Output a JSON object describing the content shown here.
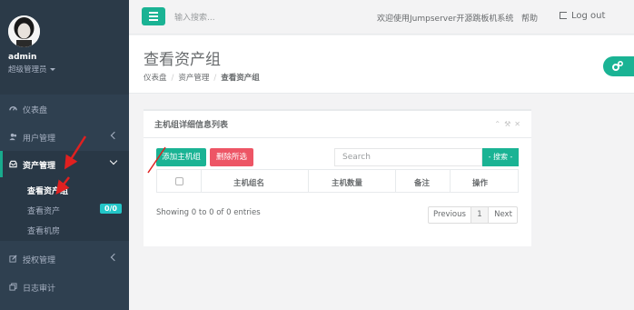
{
  "sidebar": {
    "profile": {
      "name": "admin",
      "role": "超级管理员"
    },
    "items": [
      {
        "label": "仪表盘",
        "icon": "dashboard-icon"
      },
      {
        "label": "用户管理",
        "icon": "users-icon"
      },
      {
        "label": "资产管理",
        "icon": "inbox-icon"
      },
      {
        "label": "授权管理",
        "icon": "edit-icon"
      },
      {
        "label": "日志审计",
        "icon": "copy-icon"
      }
    ],
    "sub_items": [
      {
        "label": "查看资产组"
      },
      {
        "label": "查看资产"
      },
      {
        "label": "查看机房"
      }
    ],
    "asset_badge": "0/0"
  },
  "topbar": {
    "search_placeholder": "输入搜索...",
    "welcome": "欢迎使用Jumpserver开源跳板机系统",
    "help": "帮助",
    "logout": "Log out"
  },
  "page": {
    "title": "查看资产组",
    "breadcrumb": [
      "仪表盘",
      "资产管理",
      "查看资产组"
    ]
  },
  "panel": {
    "title": "主机组详细信息列表",
    "add_button": "添加主机组",
    "delete_button": "删除所选",
    "search_placeholder": "Search",
    "search_button": "- 搜索 -",
    "columns": [
      "主机组名",
      "主机数量",
      "备注",
      "操作"
    ],
    "showing": "Showing 0 to 0 of 0 entries",
    "pagination": {
      "prev": "Previous",
      "page": "1",
      "next": "Next"
    }
  },
  "colors": {
    "sidebar": "#2f4050",
    "accent": "#1ab394",
    "danger": "#ed5565",
    "badge": "#23c6c8",
    "annotation_arrow": "#e02020"
  }
}
